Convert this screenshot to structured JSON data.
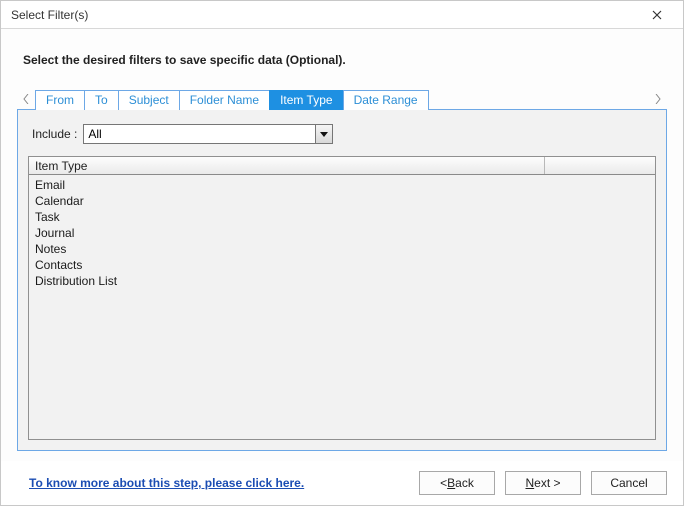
{
  "window": {
    "title": "Select Filter(s)"
  },
  "intro": "Select the desired filters to save specific data (Optional).",
  "tabs": [
    {
      "label": "From",
      "active": false
    },
    {
      "label": "To",
      "active": false
    },
    {
      "label": "Subject",
      "active": false
    },
    {
      "label": "Folder Name",
      "active": false
    },
    {
      "label": "Item Type",
      "active": true
    },
    {
      "label": "Date Range",
      "active": false
    }
  ],
  "include": {
    "label": "Include :",
    "value": "All"
  },
  "list": {
    "header": "Item Type",
    "items": [
      "Email",
      "Calendar",
      "Task",
      "Journal",
      "Notes",
      "Contacts",
      "Distribution List"
    ]
  },
  "help_link": "To know more about this step, please click here.",
  "buttons": {
    "back_prefix": "< ",
    "back_mn": "B",
    "back_rest": "ack",
    "next_mn": "N",
    "next_rest": "ext >",
    "cancel": "Cancel"
  }
}
